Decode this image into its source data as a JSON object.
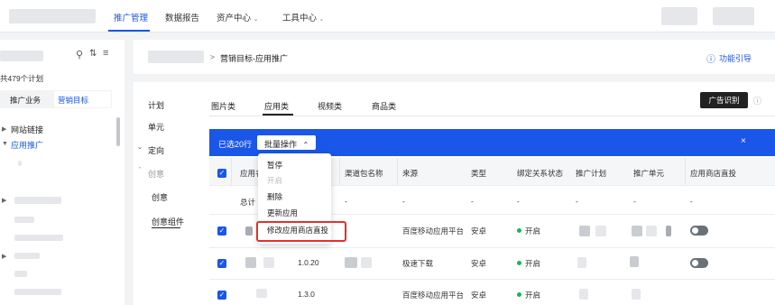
{
  "topnav": {
    "items": [
      "推广管理",
      "数据报告",
      "资产中心",
      "工具中心"
    ],
    "active_index": 0
  },
  "sidebar": {
    "plan_count": "共479个计划",
    "tabs": [
      "推广业务",
      "营销目标"
    ],
    "tree": [
      "网站链接",
      "应用推广"
    ]
  },
  "breadcrumb": {
    "separator": ">",
    "current": "营销目标-应用推广",
    "guide_link": "功能引导"
  },
  "left_nav": {
    "items": [
      "计划",
      "单元",
      "定向",
      "创意",
      "创意",
      "创意组件"
    ]
  },
  "tabs": {
    "items": [
      "图片类",
      "应用类",
      "视频类",
      "商品类"
    ],
    "active_index": 1,
    "ad_recognition_button": "广告识别"
  },
  "selection_bar": {
    "selected_text": "已选20行",
    "batch_button": "批量操作"
  },
  "batch_menu": {
    "items": [
      "暂停",
      "开启",
      "删除",
      "更新应用",
      "修改应用商店直投"
    ],
    "disabled_index": 1,
    "highlighted_index": 4
  },
  "table": {
    "headers": [
      "应用名",
      "渠道包名称",
      "来源",
      "类型",
      "绑定关系状态",
      "推广计划",
      "推广单元",
      "应用商店直投"
    ],
    "total_row": {
      "label": "总计",
      "dashes": [
        "-",
        "-",
        "-",
        "-",
        "-",
        "-",
        "-"
      ]
    },
    "rows": [
      {
        "version": "",
        "package": "-",
        "source": "百度移动应用平台",
        "type": "安卓",
        "status": "开启"
      },
      {
        "version": "1.0.20",
        "package": "",
        "source": "极速下载",
        "type": "安卓",
        "status": "开启"
      },
      {
        "version": "1.3.0",
        "package": "",
        "source": "百度移动应用平台",
        "type": "安卓",
        "status": "开启"
      }
    ]
  }
}
